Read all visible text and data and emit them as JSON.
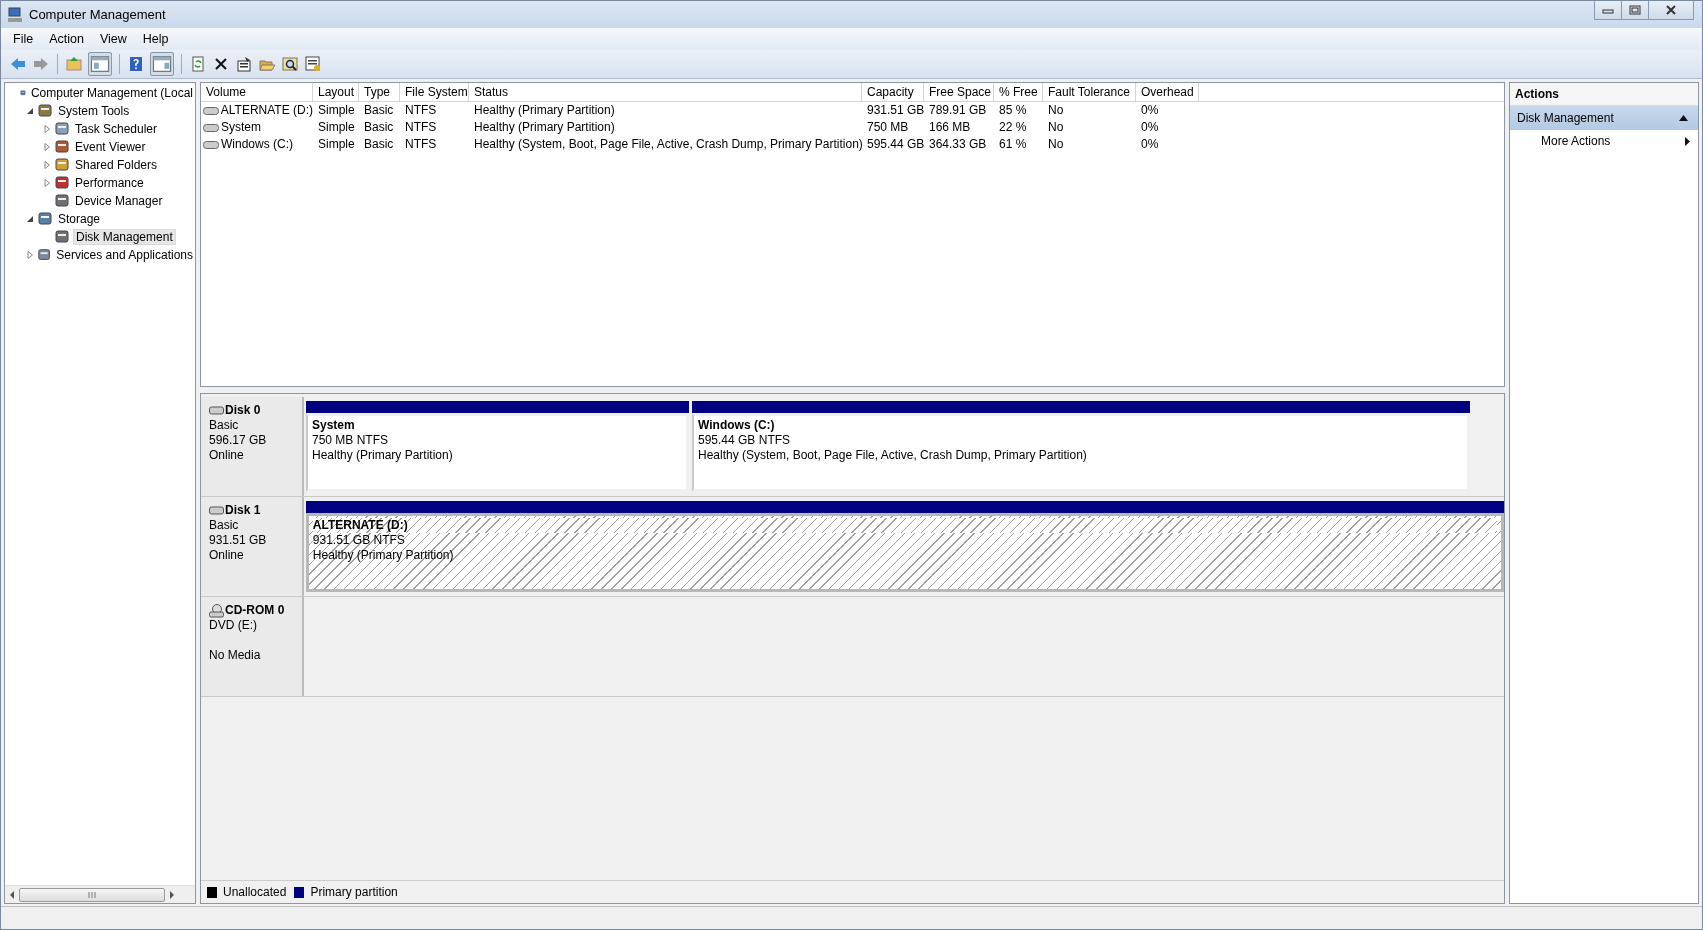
{
  "window": {
    "title": "Computer Management"
  },
  "menu": [
    "File",
    "Action",
    "View",
    "Help"
  ],
  "tree": [
    {
      "label": "Computer Management (Local",
      "selected": false,
      "children": [
        {
          "label": "System Tools",
          "expanded": true,
          "selected": false,
          "children": [
            {
              "label": "Task Scheduler",
              "expanded": false,
              "selected": false
            },
            {
              "label": "Event Viewer",
              "expanded": false,
              "selected": false
            },
            {
              "label": "Shared Folders",
              "expanded": false,
              "selected": false
            },
            {
              "label": "Performance",
              "expanded": false,
              "selected": false
            },
            {
              "label": "Device Manager",
              "selected": false
            }
          ]
        },
        {
          "label": "Storage",
          "expanded": true,
          "selected": false,
          "children": [
            {
              "label": "Disk Management",
              "selected": true
            }
          ]
        },
        {
          "label": "Services and Applications",
          "expanded": false,
          "selected": false
        }
      ]
    }
  ],
  "table": {
    "columns": [
      "Volume",
      "Layout",
      "Type",
      "File System",
      "Status",
      "Capacity",
      "Free Space",
      "% Free",
      "Fault Tolerance",
      "Overhead"
    ],
    "rows": [
      [
        "ALTERNATE (D:)",
        "Simple",
        "Basic",
        "NTFS",
        "Healthy (Primary Partition)",
        "931.51 GB",
        "789.91 GB",
        "85 %",
        "No",
        "0%"
      ],
      [
        "System",
        "Simple",
        "Basic",
        "NTFS",
        "Healthy (Primary Partition)",
        "750 MB",
        "166 MB",
        "22 %",
        "No",
        "0%"
      ],
      [
        "Windows (C:)",
        "Simple",
        "Basic",
        "NTFS",
        "Healthy (System, Boot, Page File, Active, Crash Dump, Primary Partition)",
        "595.44 GB",
        "364.33 GB",
        "61 %",
        "No",
        "0%"
      ]
    ]
  },
  "disks": [
    {
      "kind": "disk",
      "name": "Disk 0",
      "type": "Basic",
      "size": "596.17 GB",
      "status": "Online",
      "partitions": [
        {
          "name": "System",
          "size": "750 MB NTFS",
          "status": "Healthy (Primary Partition)",
          "selected": false
        },
        {
          "name": "Windows  (C:)",
          "size": "595.44 GB NTFS",
          "status": "Healthy (System, Boot, Page File, Active, Crash Dump, Primary Partition)",
          "selected": false
        }
      ]
    },
    {
      "kind": "disk",
      "name": "Disk 1",
      "type": "Basic",
      "size": "931.51 GB",
      "status": "Online",
      "partitions": [
        {
          "name": "ALTERNATE  (D:)",
          "size": "931.51 GB NTFS",
          "status": "Healthy (Primary Partition)",
          "selected": true
        }
      ]
    },
    {
      "kind": "cdrom",
      "name": "CD-ROM 0",
      "type": "DVD (E:)",
      "status": "No Media"
    }
  ],
  "legend": [
    {
      "label": "Unallocated",
      "color": "#000000"
    },
    {
      "label": "Primary partition",
      "color": "#000080"
    }
  ],
  "actions": {
    "title": "Actions",
    "section": {
      "label": "Disk Management",
      "expanded": true
    },
    "items": [
      "More Actions"
    ]
  }
}
